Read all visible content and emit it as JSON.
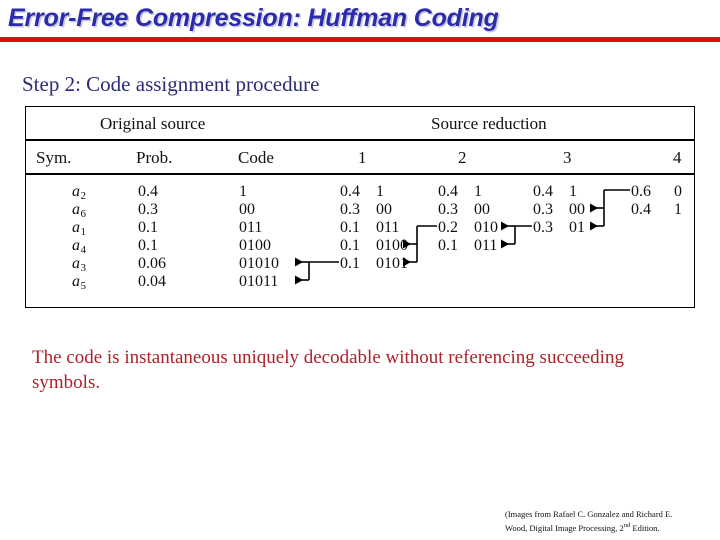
{
  "slide": {
    "title": "Error-Free Compression: Huffman Coding",
    "title_color": "#2b2bae",
    "rule_color": "#e8070c",
    "step_heading": "Step 2: Code assignment procedure",
    "step_heading_color": "#2b2b77",
    "conclusion": "The code is instantaneous uniquely decodable without referencing succeeding symbols.",
    "conclusion_color": "#b0202a"
  },
  "table": {
    "group_headers": [
      {
        "label": "Original source"
      },
      {
        "label": "Source reduction"
      }
    ],
    "column_headers": [
      "Sym.",
      "Prob.",
      "Code",
      "1",
      "2",
      "3",
      "4"
    ],
    "symbols": [
      "a",
      "a",
      "a",
      "a",
      "a",
      "a"
    ],
    "symbol_subs": [
      "2",
      "6",
      "1",
      "4",
      "3",
      "5"
    ],
    "original": {
      "prob": [
        "0.4",
        "0.3",
        "0.1",
        "0.1",
        "0.06",
        "0.04"
      ],
      "code": [
        "1",
        "00",
        "011",
        "0100",
        "01010",
        "01011"
      ]
    },
    "reduction1": {
      "prob": [
        "0.4",
        "0.3",
        "0.1",
        "0.1",
        "0.1"
      ],
      "code": [
        "1",
        "00",
        "011",
        "0100",
        "0101"
      ]
    },
    "reduction2": {
      "prob": [
        "0.4",
        "0.3",
        "0.2",
        "0.1"
      ],
      "code": [
        "1",
        "00",
        "010",
        "011"
      ]
    },
    "reduction3": {
      "prob": [
        "0.4",
        "0.3",
        "0.3"
      ],
      "code": [
        "1",
        "00",
        "01"
      ]
    },
    "reduction4": {
      "prob": [
        "0.6",
        "0.4"
      ],
      "code": [
        "0",
        "1"
      ]
    }
  },
  "credit": {
    "line1": "(Images from Rafael C. Gonzalez and Richard E.",
    "line2_pre": "Wood, Digital Image Processing, 2",
    "line2_sup": "nd",
    "line2_post": " Edition."
  }
}
